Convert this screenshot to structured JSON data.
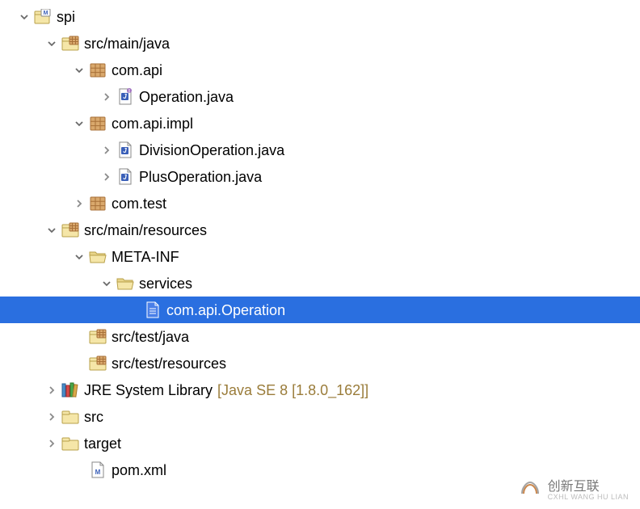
{
  "tree": [
    {
      "depth": 0,
      "arrow": "down",
      "icon": "project-maven",
      "label": "spi",
      "selected": false,
      "name": "project-root"
    },
    {
      "depth": 1,
      "arrow": "down",
      "icon": "source-folder",
      "label": "src/main/java",
      "selected": false,
      "name": "folder-src-main-java"
    },
    {
      "depth": 2,
      "arrow": "down",
      "icon": "package",
      "label": "com.api",
      "selected": false,
      "name": "package-com-api"
    },
    {
      "depth": 3,
      "arrow": "right",
      "icon": "java-interface",
      "label": "Operation.java",
      "selected": false,
      "name": "file-operation-java"
    },
    {
      "depth": 2,
      "arrow": "down",
      "icon": "package",
      "label": "com.api.impl",
      "selected": false,
      "name": "package-com-api-impl"
    },
    {
      "depth": 3,
      "arrow": "right",
      "icon": "java-file",
      "label": "DivisionOperation.java",
      "selected": false,
      "name": "file-divisionoperation-java"
    },
    {
      "depth": 3,
      "arrow": "right",
      "icon": "java-file",
      "label": "PlusOperation.java",
      "selected": false,
      "name": "file-plusoperation-java"
    },
    {
      "depth": 2,
      "arrow": "right",
      "icon": "package",
      "label": "com.test",
      "selected": false,
      "name": "package-com-test"
    },
    {
      "depth": 1,
      "arrow": "down",
      "icon": "source-folder",
      "label": "src/main/resources",
      "selected": false,
      "name": "folder-src-main-resources"
    },
    {
      "depth": 2,
      "arrow": "down",
      "icon": "folder-open",
      "label": "META-INF",
      "selected": false,
      "name": "folder-meta-inf"
    },
    {
      "depth": 3,
      "arrow": "down",
      "icon": "folder-open",
      "label": "services",
      "selected": false,
      "name": "folder-services"
    },
    {
      "depth": 4,
      "arrow": "none",
      "icon": "text-file",
      "label": "com.api.Operation",
      "selected": true,
      "name": "file-com-api-operation"
    },
    {
      "depth": 2,
      "arrow": "none",
      "icon": "source-folder",
      "label": "src/test/java",
      "selected": false,
      "name": "folder-src-test-java"
    },
    {
      "depth": 2,
      "arrow": "none",
      "icon": "source-folder",
      "label": "src/test/resources",
      "selected": false,
      "name": "folder-src-test-resources"
    },
    {
      "depth": 1,
      "arrow": "right",
      "icon": "library",
      "label": "JRE System Library",
      "suffix": "[Java SE 8 [1.8.0_162]]",
      "selected": false,
      "name": "jre-system-library"
    },
    {
      "depth": 1,
      "arrow": "right",
      "icon": "folder-closed",
      "label": "src",
      "selected": false,
      "name": "folder-src"
    },
    {
      "depth": 1,
      "arrow": "right",
      "icon": "folder-closed",
      "label": "target",
      "selected": false,
      "name": "folder-target"
    },
    {
      "depth": 2,
      "arrow": "none",
      "icon": "xml-file",
      "label": "pom.xml",
      "selected": false,
      "name": "file-pom-xml"
    }
  ],
  "indent_base": 22,
  "indent_step": 34,
  "watermark": {
    "main": "创新互联",
    "sub": "CXHL WANG HU LIAN"
  }
}
